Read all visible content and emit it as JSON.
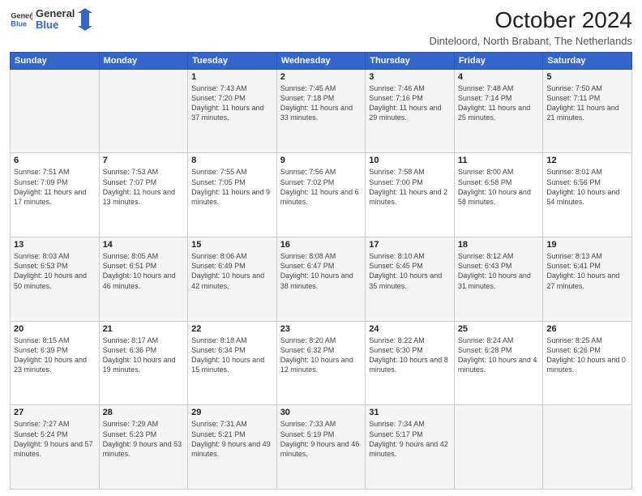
{
  "header": {
    "logo": {
      "line1": "General",
      "line2": "Blue"
    },
    "title": "October 2024",
    "location": "Dinteloord, North Brabant, The Netherlands"
  },
  "weekdays": [
    "Sunday",
    "Monday",
    "Tuesday",
    "Wednesday",
    "Thursday",
    "Friday",
    "Saturday"
  ],
  "weeks": [
    [
      {
        "day": "",
        "sunrise": "",
        "sunset": "",
        "daylight": ""
      },
      {
        "day": "",
        "sunrise": "",
        "sunset": "",
        "daylight": ""
      },
      {
        "day": "1",
        "sunrise": "Sunrise: 7:43 AM",
        "sunset": "Sunset: 7:20 PM",
        "daylight": "Daylight: 11 hours and 37 minutes."
      },
      {
        "day": "2",
        "sunrise": "Sunrise: 7:45 AM",
        "sunset": "Sunset: 7:18 PM",
        "daylight": "Daylight: 11 hours and 33 minutes."
      },
      {
        "day": "3",
        "sunrise": "Sunrise: 7:46 AM",
        "sunset": "Sunset: 7:16 PM",
        "daylight": "Daylight: 11 hours and 29 minutes."
      },
      {
        "day": "4",
        "sunrise": "Sunrise: 7:48 AM",
        "sunset": "Sunset: 7:14 PM",
        "daylight": "Daylight: 11 hours and 25 minutes."
      },
      {
        "day": "5",
        "sunrise": "Sunrise: 7:50 AM",
        "sunset": "Sunset: 7:11 PM",
        "daylight": "Daylight: 11 hours and 21 minutes."
      }
    ],
    [
      {
        "day": "6",
        "sunrise": "Sunrise: 7:51 AM",
        "sunset": "Sunset: 7:09 PM",
        "daylight": "Daylight: 11 hours and 17 minutes."
      },
      {
        "day": "7",
        "sunrise": "Sunrise: 7:53 AM",
        "sunset": "Sunset: 7:07 PM",
        "daylight": "Daylight: 11 hours and 13 minutes."
      },
      {
        "day": "8",
        "sunrise": "Sunrise: 7:55 AM",
        "sunset": "Sunset: 7:05 PM",
        "daylight": "Daylight: 11 hours and 9 minutes."
      },
      {
        "day": "9",
        "sunrise": "Sunrise: 7:56 AM",
        "sunset": "Sunset: 7:02 PM",
        "daylight": "Daylight: 11 hours and 6 minutes."
      },
      {
        "day": "10",
        "sunrise": "Sunrise: 7:58 AM",
        "sunset": "Sunset: 7:00 PM",
        "daylight": "Daylight: 11 hours and 2 minutes."
      },
      {
        "day": "11",
        "sunrise": "Sunrise: 8:00 AM",
        "sunset": "Sunset: 6:58 PM",
        "daylight": "Daylight: 10 hours and 58 minutes."
      },
      {
        "day": "12",
        "sunrise": "Sunrise: 8:01 AM",
        "sunset": "Sunset: 6:56 PM",
        "daylight": "Daylight: 10 hours and 54 minutes."
      }
    ],
    [
      {
        "day": "13",
        "sunrise": "Sunrise: 8:03 AM",
        "sunset": "Sunset: 6:53 PM",
        "daylight": "Daylight: 10 hours and 50 minutes."
      },
      {
        "day": "14",
        "sunrise": "Sunrise: 8:05 AM",
        "sunset": "Sunset: 6:51 PM",
        "daylight": "Daylight: 10 hours and 46 minutes."
      },
      {
        "day": "15",
        "sunrise": "Sunrise: 8:06 AM",
        "sunset": "Sunset: 6:49 PM",
        "daylight": "Daylight: 10 hours and 42 minutes."
      },
      {
        "day": "16",
        "sunrise": "Sunrise: 8:08 AM",
        "sunset": "Sunset: 6:47 PM",
        "daylight": "Daylight: 10 hours and 38 minutes."
      },
      {
        "day": "17",
        "sunrise": "Sunrise: 8:10 AM",
        "sunset": "Sunset: 6:45 PM",
        "daylight": "Daylight: 10 hours and 35 minutes."
      },
      {
        "day": "18",
        "sunrise": "Sunrise: 8:12 AM",
        "sunset": "Sunset: 6:43 PM",
        "daylight": "Daylight: 10 hours and 31 minutes."
      },
      {
        "day": "19",
        "sunrise": "Sunrise: 8:13 AM",
        "sunset": "Sunset: 6:41 PM",
        "daylight": "Daylight: 10 hours and 27 minutes."
      }
    ],
    [
      {
        "day": "20",
        "sunrise": "Sunrise: 8:15 AM",
        "sunset": "Sunset: 6:39 PM",
        "daylight": "Daylight: 10 hours and 23 minutes."
      },
      {
        "day": "21",
        "sunrise": "Sunrise: 8:17 AM",
        "sunset": "Sunset: 6:36 PM",
        "daylight": "Daylight: 10 hours and 19 minutes."
      },
      {
        "day": "22",
        "sunrise": "Sunrise: 8:18 AM",
        "sunset": "Sunset: 6:34 PM",
        "daylight": "Daylight: 10 hours and 15 minutes."
      },
      {
        "day": "23",
        "sunrise": "Sunrise: 8:20 AM",
        "sunset": "Sunset: 6:32 PM",
        "daylight": "Daylight: 10 hours and 12 minutes."
      },
      {
        "day": "24",
        "sunrise": "Sunrise: 8:22 AM",
        "sunset": "Sunset: 6:30 PM",
        "daylight": "Daylight: 10 hours and 8 minutes."
      },
      {
        "day": "25",
        "sunrise": "Sunrise: 8:24 AM",
        "sunset": "Sunset: 6:28 PM",
        "daylight": "Daylight: 10 hours and 4 minutes."
      },
      {
        "day": "26",
        "sunrise": "Sunrise: 8:25 AM",
        "sunset": "Sunset: 6:26 PM",
        "daylight": "Daylight: 10 hours and 0 minutes."
      }
    ],
    [
      {
        "day": "27",
        "sunrise": "Sunrise: 7:27 AM",
        "sunset": "Sunset: 5:24 PM",
        "daylight": "Daylight: 9 hours and 57 minutes."
      },
      {
        "day": "28",
        "sunrise": "Sunrise: 7:29 AM",
        "sunset": "Sunset: 5:23 PM",
        "daylight": "Daylight: 9 hours and 53 minutes."
      },
      {
        "day": "29",
        "sunrise": "Sunrise: 7:31 AM",
        "sunset": "Sunset: 5:21 PM",
        "daylight": "Daylight: 9 hours and 49 minutes."
      },
      {
        "day": "30",
        "sunrise": "Sunrise: 7:33 AM",
        "sunset": "Sunset: 5:19 PM",
        "daylight": "Daylight: 9 hours and 46 minutes."
      },
      {
        "day": "31",
        "sunrise": "Sunrise: 7:34 AM",
        "sunset": "Sunset: 5:17 PM",
        "daylight": "Daylight: 9 hours and 42 minutes."
      },
      {
        "day": "",
        "sunrise": "",
        "sunset": "",
        "daylight": ""
      },
      {
        "day": "",
        "sunrise": "",
        "sunset": "",
        "daylight": ""
      }
    ]
  ]
}
